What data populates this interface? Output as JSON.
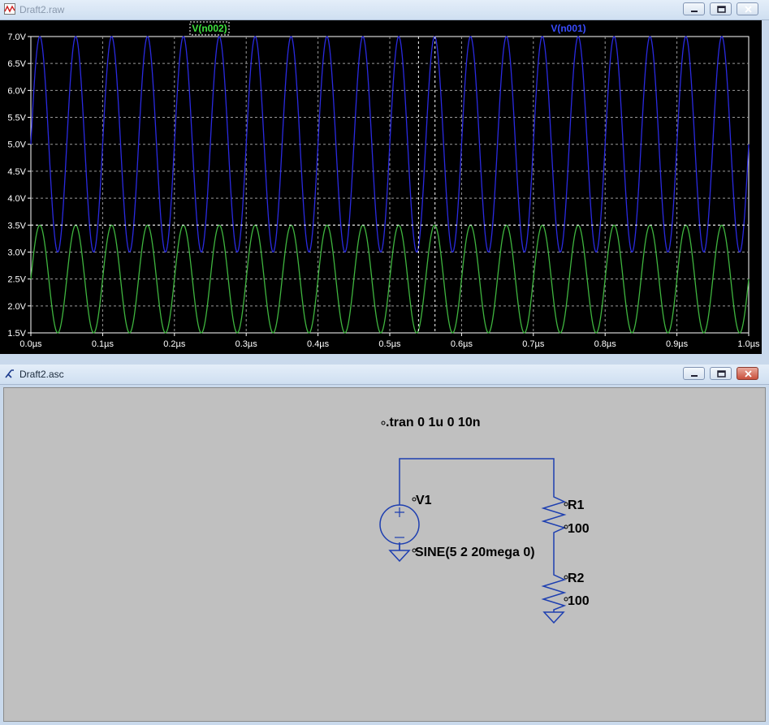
{
  "plot_window": {
    "title": "Draft2.raw",
    "title_state": "inactive",
    "buttons": [
      "minimize",
      "maximize",
      "close"
    ]
  },
  "schematic_window": {
    "title": "Draft2.asc",
    "buttons": [
      "minimize",
      "maximize",
      "close"
    ],
    "directive": ".tran 0 1u 0 10n",
    "source": {
      "name": "V1",
      "value": "SINE(5 2 20mega 0)"
    },
    "resistors": [
      {
        "name": "R1",
        "value": "100"
      },
      {
        "name": "R2",
        "value": "100"
      }
    ]
  },
  "chart_data": {
    "type": "line",
    "x_ticks": [
      "0.0µs",
      "0.1µs",
      "0.2µs",
      "0.3µs",
      "0.4µs",
      "0.5µs",
      "0.6µs",
      "0.7µs",
      "0.8µs",
      "0.9µs",
      "1.0µs"
    ],
    "y_ticks": [
      "7.0V",
      "6.5V",
      "6.0V",
      "5.5V",
      "5.0V",
      "4.5V",
      "4.0V",
      "3.5V",
      "3.0V",
      "2.5V",
      "2.0V",
      "1.5V"
    ],
    "xlim": [
      0,
      1.0
    ],
    "ylim": [
      1.5,
      7.0
    ],
    "x_unit": "µs",
    "grid": true,
    "series": [
      {
        "name": "V(n001)",
        "color": "#2a2ae0",
        "offset": 5.0,
        "amplitude": 2.0,
        "frequency_MHz": 20,
        "phase": 0
      },
      {
        "name": "V(n002)",
        "color": "#3fb53f",
        "offset": 2.5,
        "amplitude": 1.0,
        "frequency_MHz": 20,
        "phase": 0
      }
    ],
    "cursor_lines_us": [
      0.54,
      0.563
    ]
  },
  "colors": {
    "plot_bg": "#000000",
    "grid": "#9a9a9a",
    "wire": "#1e3fb0",
    "schematic_bg": "#c0c0c0"
  }
}
